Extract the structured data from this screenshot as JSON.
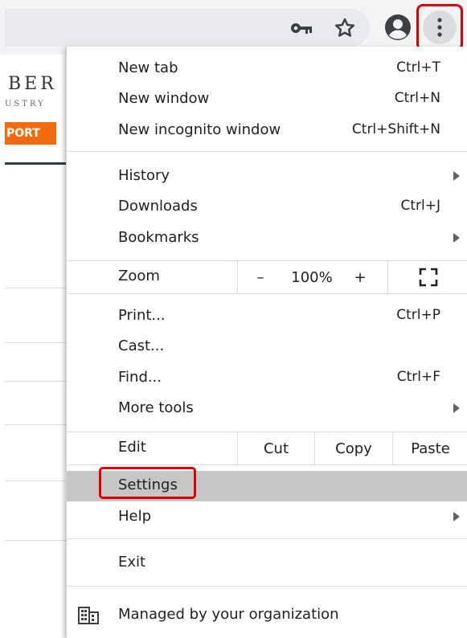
{
  "toolbar": {
    "key_icon": "key-icon",
    "star_icon": "star-icon",
    "account_icon": "account-circle-icon",
    "menu_icon": "three-dot-menu-icon",
    "highlight_color": "#e00000"
  },
  "background_page": {
    "brand": "BER",
    "brand_sub": "USTRY",
    "report_button": "PORT",
    "accent": "#f26c0f"
  },
  "menu": {
    "items": [
      {
        "label": "New tab",
        "shortcut": "Ctrl+T"
      },
      {
        "label": "New window",
        "shortcut": "Ctrl+N"
      },
      {
        "label": "New incognito window",
        "shortcut": "Ctrl+Shift+N"
      },
      {
        "label": "History",
        "submenu": true
      },
      {
        "label": "Downloads",
        "shortcut": "Ctrl+J"
      },
      {
        "label": "Bookmarks",
        "submenu": true
      }
    ],
    "zoom": {
      "label": "Zoom",
      "minus": "–",
      "value": "100%",
      "plus": "+",
      "fullscreen_icon": "fullscreen-icon"
    },
    "items2": [
      {
        "label": "Print...",
        "shortcut": "Ctrl+P"
      },
      {
        "label": "Cast..."
      },
      {
        "label": "Find...",
        "shortcut": "Ctrl+F"
      },
      {
        "label": "More tools",
        "submenu": true
      }
    ],
    "edit": {
      "label": "Edit",
      "cut": "Cut",
      "copy": "Copy",
      "paste": "Paste"
    },
    "settings": {
      "label": "Settings",
      "highlighted": true
    },
    "help": {
      "label": "Help",
      "submenu": true
    },
    "exit": {
      "label": "Exit"
    },
    "managed": {
      "label": "Managed by your organization",
      "icon": "building-icon"
    }
  }
}
